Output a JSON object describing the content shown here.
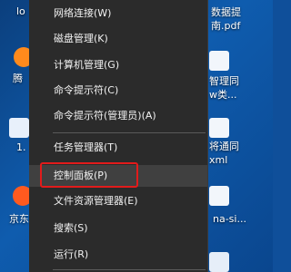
{
  "desktop": {
    "left_icons": [
      {
        "label": "lo"
      },
      {
        "label": "腾"
      },
      {
        "label": "1."
      },
      {
        "label": "京东"
      }
    ],
    "right_icons": [
      {
        "label_line1": "数据提",
        "label_line2": "南.pdf"
      },
      {
        "label_line1": "智理同",
        "label_line2": "w类..."
      },
      {
        "label_line1": "将通同",
        "label_line2": "xml"
      },
      {
        "label_line1": "na-si..."
      },
      {
        "label_line1": ""
      }
    ]
  },
  "context_menu": {
    "items": [
      {
        "label": "网络连接(W)"
      },
      {
        "label": "磁盘管理(K)"
      },
      {
        "label": "计算机管理(G)"
      },
      {
        "label": "命令提示符(C)"
      },
      {
        "label": "命令提示符(管理员)(A)"
      },
      {
        "label": "任务管理器(T)"
      },
      {
        "label": "控制面板(P)"
      },
      {
        "label": "文件资源管理器(E)"
      },
      {
        "label": "搜索(S)"
      },
      {
        "label": "运行(R)"
      }
    ],
    "highlighted_index": 6
  },
  "colors": {
    "menu_bg": "#2b2b2b",
    "menu_text": "#f2f2f2",
    "highlight_bg": "#404040",
    "annotation_red": "#e21b1b",
    "desktop_blue": "#0f5cae"
  }
}
